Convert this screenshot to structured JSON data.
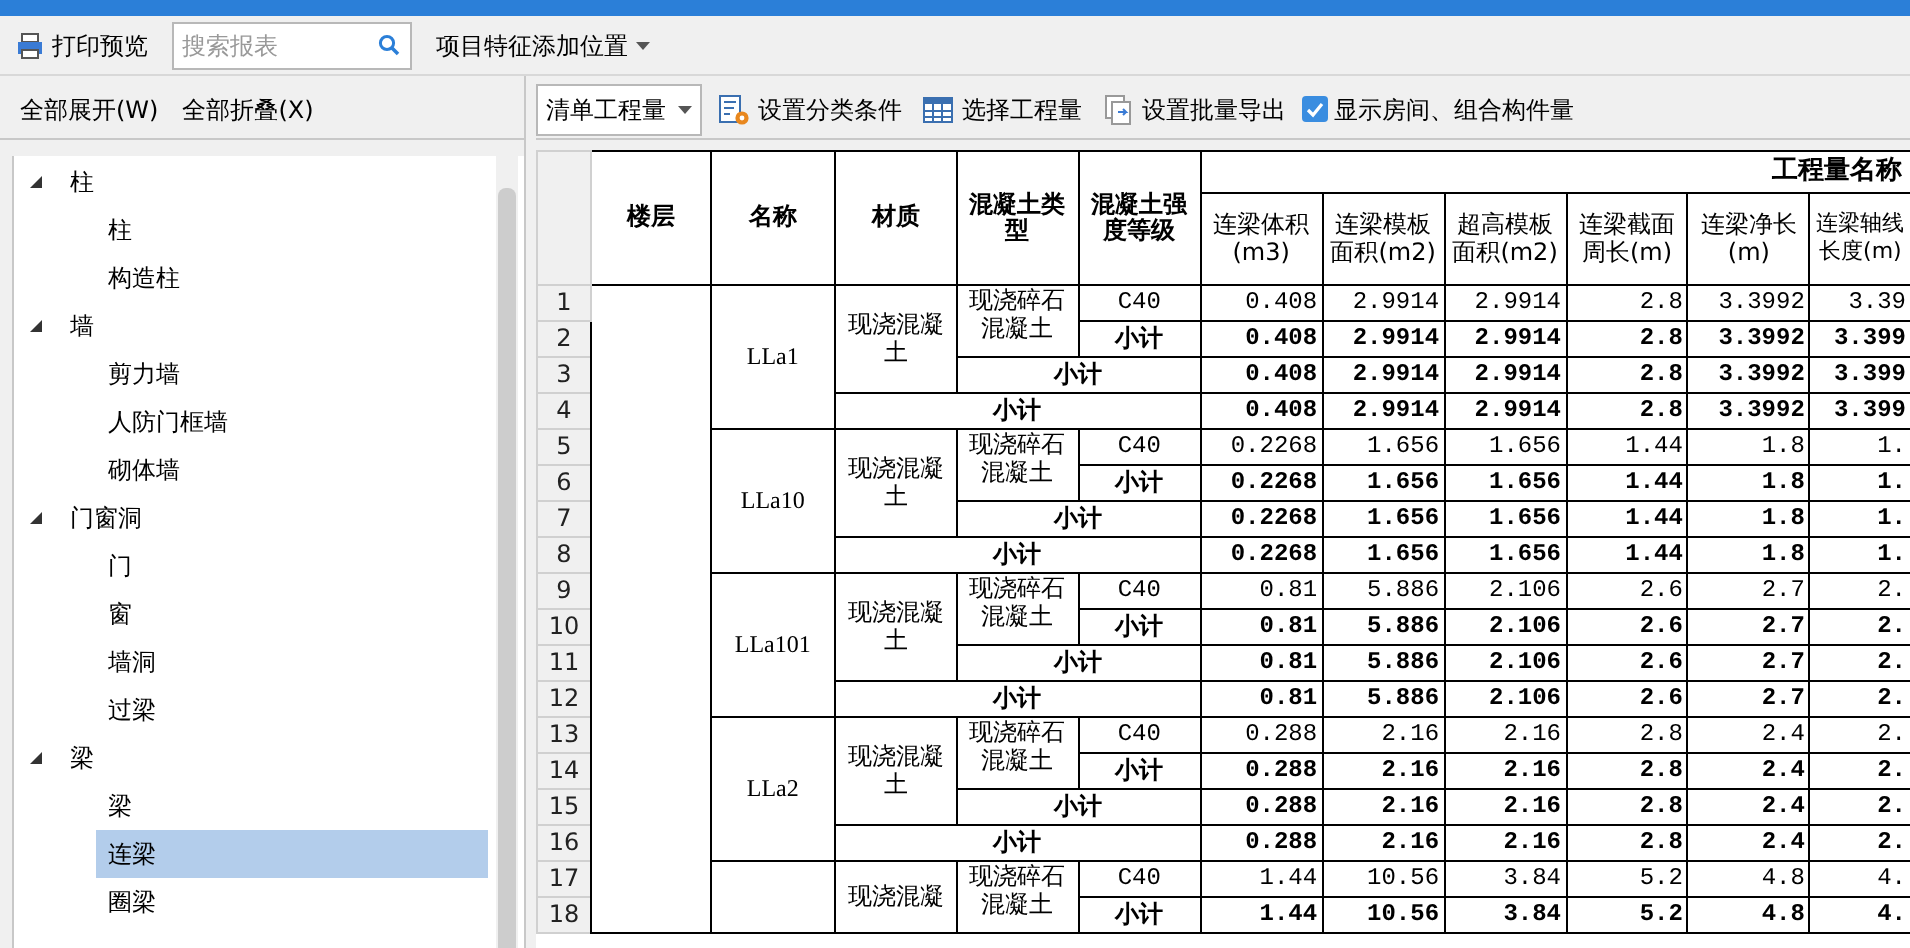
{
  "toolbar": {
    "print_preview": "打印预览",
    "search": {
      "placeholder": "搜索报表"
    },
    "position_menu": "项目特征添加位置"
  },
  "tree_panel": {
    "expand_all": "全部展开(W)",
    "collapse_all": "全部折叠(X)",
    "items": [
      {
        "label": "柱",
        "expanded": true,
        "selected": false,
        "children": [
          {
            "label": "柱",
            "selected": false
          },
          {
            "label": "构造柱",
            "selected": false
          }
        ]
      },
      {
        "label": "墙",
        "expanded": true,
        "selected": false,
        "children": [
          {
            "label": "剪力墙",
            "selected": false
          },
          {
            "label": "人防门框墙",
            "selected": false
          },
          {
            "label": "砌体墙",
            "selected": false
          }
        ]
      },
      {
        "label": "门窗洞",
        "expanded": true,
        "selected": false,
        "children": [
          {
            "label": "门",
            "selected": false
          },
          {
            "label": "窗",
            "selected": false
          },
          {
            "label": "墙洞",
            "selected": false
          },
          {
            "label": "过梁",
            "selected": false
          }
        ]
      },
      {
        "label": "梁",
        "expanded": true,
        "selected": false,
        "children": [
          {
            "label": "梁",
            "selected": false
          },
          {
            "label": "连梁",
            "selected": true
          },
          {
            "label": "圈梁",
            "selected": false
          }
        ]
      }
    ]
  },
  "report_toolbar": {
    "quantity_type": "清单工程量",
    "buttons": [
      {
        "kind": "classify",
        "label": "设置分类条件"
      },
      {
        "kind": "select",
        "label": "选择工程量"
      },
      {
        "kind": "export",
        "label": "设置批量导出"
      }
    ],
    "show_rooms": {
      "label": "显示房间、组合构件量",
      "checked": true
    }
  },
  "table": {
    "columns": {
      "floor": "楼层",
      "name": "名称",
      "material": "材质",
      "concrete_type": "混凝土类型",
      "grade": "混凝土强度等级",
      "quantity_group": "工程量名称",
      "quantities": [
        "连梁体积(m3)",
        "连梁模板面积(m2)",
        "超高模板面积(m2)",
        "连梁截面周长(m)",
        "连梁净长(m)",
        "连梁轴线长度(m)"
      ]
    },
    "groups": [
      {
        "name": "LLa1",
        "material": "现浇混凝土",
        "concrete_type": "现浇碎石混凝土",
        "rows": [
          {
            "number": "1",
            "kind": "detail",
            "label": "C40",
            "values": [
              "0.408",
              "2.9914",
              "2.9914",
              "2.8",
              "3.3992",
              "3.39"
            ]
          },
          {
            "number": "2",
            "kind": "grade_subtotal",
            "label": "小计",
            "values": [
              "0.408",
              "2.9914",
              "2.9914",
              "2.8",
              "3.3992",
              "3.399"
            ]
          },
          {
            "number": "3",
            "kind": "type_subtotal",
            "label": "小计",
            "values": [
              "0.408",
              "2.9914",
              "2.9914",
              "2.8",
              "3.3992",
              "3.399"
            ]
          },
          {
            "number": "4",
            "kind": "name_subtotal",
            "label": "小计",
            "values": [
              "0.408",
              "2.9914",
              "2.9914",
              "2.8",
              "3.3992",
              "3.399"
            ]
          }
        ]
      },
      {
        "name": "LLa10",
        "material": "现浇混凝土",
        "concrete_type": "现浇碎石混凝土",
        "rows": [
          {
            "number": "5",
            "kind": "detail",
            "label": "C40",
            "values": [
              "0.2268",
              "1.656",
              "1.656",
              "1.44",
              "1.8",
              "1."
            ]
          },
          {
            "number": "6",
            "kind": "grade_subtotal",
            "label": "小计",
            "values": [
              "0.2268",
              "1.656",
              "1.656",
              "1.44",
              "1.8",
              "1."
            ]
          },
          {
            "number": "7",
            "kind": "type_subtotal",
            "label": "小计",
            "values": [
              "0.2268",
              "1.656",
              "1.656",
              "1.44",
              "1.8",
              "1."
            ]
          },
          {
            "number": "8",
            "kind": "name_subtotal",
            "label": "小计",
            "values": [
              "0.2268",
              "1.656",
              "1.656",
              "1.44",
              "1.8",
              "1."
            ]
          }
        ]
      },
      {
        "name": "LLa101",
        "material": "现浇混凝土",
        "concrete_type": "现浇碎石混凝土",
        "rows": [
          {
            "number": "9",
            "kind": "detail",
            "label": "C40",
            "values": [
              "0.81",
              "5.886",
              "2.106",
              "2.6",
              "2.7",
              "2."
            ]
          },
          {
            "number": "10",
            "kind": "grade_subtotal",
            "label": "小计",
            "values": [
              "0.81",
              "5.886",
              "2.106",
              "2.6",
              "2.7",
              "2."
            ]
          },
          {
            "number": "11",
            "kind": "type_subtotal",
            "label": "小计",
            "values": [
              "0.81",
              "5.886",
              "2.106",
              "2.6",
              "2.7",
              "2."
            ]
          },
          {
            "number": "12",
            "kind": "name_subtotal",
            "label": "小计",
            "values": [
              "0.81",
              "5.886",
              "2.106",
              "2.6",
              "2.7",
              "2."
            ]
          }
        ]
      },
      {
        "name": "LLa2",
        "material": "现浇混凝土",
        "concrete_type": "现浇碎石混凝土",
        "rows": [
          {
            "number": "13",
            "kind": "detail",
            "label": "C40",
            "values": [
              "0.288",
              "2.16",
              "2.16",
              "2.8",
              "2.4",
              "2."
            ]
          },
          {
            "number": "14",
            "kind": "grade_subtotal",
            "label": "小计",
            "values": [
              "0.288",
              "2.16",
              "2.16",
              "2.8",
              "2.4",
              "2."
            ]
          },
          {
            "number": "15",
            "kind": "type_subtotal",
            "label": "小计",
            "values": [
              "0.288",
              "2.16",
              "2.16",
              "2.8",
              "2.4",
              "2."
            ]
          },
          {
            "number": "16",
            "kind": "name_subtotal",
            "label": "小计",
            "values": [
              "0.288",
              "2.16",
              "2.16",
              "2.8",
              "2.4",
              "2."
            ]
          }
        ]
      },
      {
        "material": "现浇混凝",
        "concrete_type": "现浇碎石混凝土",
        "rows": [
          {
            "number": "17",
            "kind": "detail",
            "label": "C40",
            "values": [
              "1.44",
              "10.56",
              "3.84",
              "5.2",
              "4.8",
              "4."
            ]
          },
          {
            "number": "18",
            "kind": "grade_subtotal",
            "label": "小计",
            "values": [
              "1.44",
              "10.56",
              "3.84",
              "5.2",
              "4.8",
              "4."
            ]
          }
        ]
      }
    ]
  }
}
